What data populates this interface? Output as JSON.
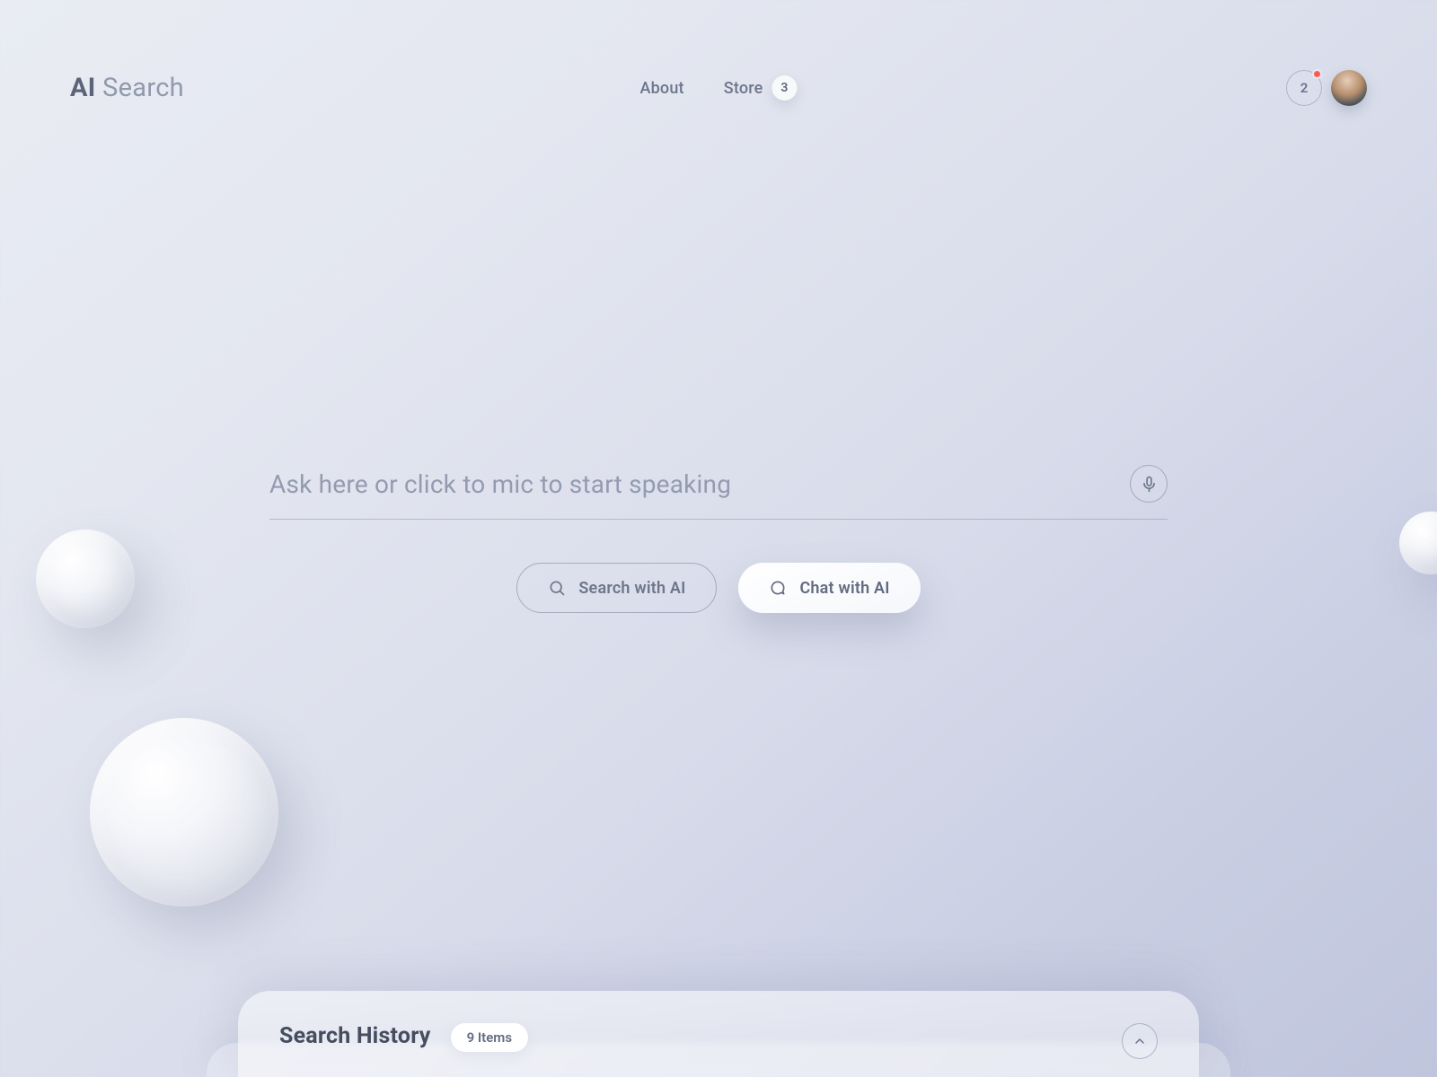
{
  "header": {
    "logo_bold": "AI",
    "logo_light": "Search",
    "nav": {
      "about_label": "About",
      "store_label": "Store",
      "store_count": "3"
    },
    "notifications_count": "2"
  },
  "search": {
    "placeholder": "Ask here or click to mic to start speaking",
    "value": "",
    "search_btn_label": "Search with AI",
    "chat_btn_label": "Chat with AI"
  },
  "history": {
    "title": "Search History",
    "items_label": "9 Items"
  }
}
